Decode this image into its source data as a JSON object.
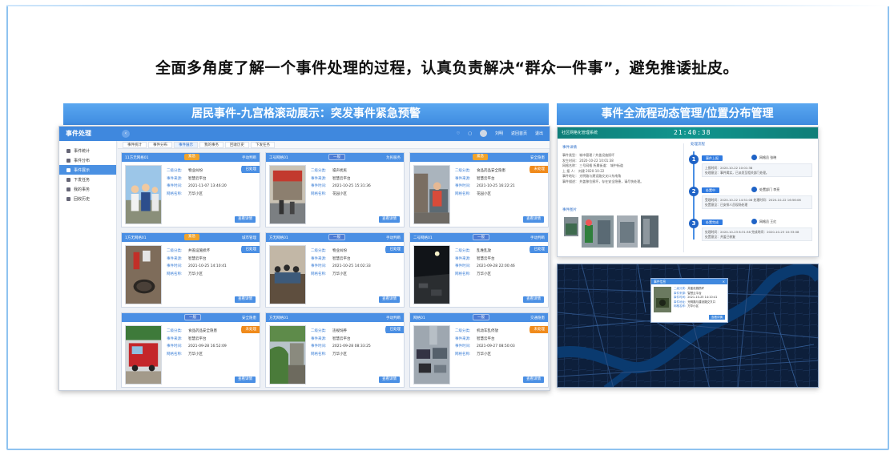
{
  "headline": "全面多角度了解一个事件处理的过程，认真负责解决“群众一件事”，避免推诿扯皮。",
  "left_section": {
    "title": "居民事件-九宫格滚动展示：突发事件紧急预警",
    "app": {
      "logo": "事件处理",
      "collapse_symbol": "‹",
      "top_right": [
        "♡",
        "▢",
        "刘明",
        "返回首页",
        "退出"
      ],
      "sidebar": [
        {
          "label": "事件统计",
          "active": false
        },
        {
          "label": "事件分布",
          "active": false
        },
        {
          "label": "事件展示",
          "active": true
        },
        {
          "label": "下发任务",
          "active": false
        },
        {
          "label": "我的事务",
          "active": false
        },
        {
          "label": "回收历史",
          "active": false
        }
      ],
      "tabs": [
        {
          "label": "事件统计",
          "active": false
        },
        {
          "label": "事件分布",
          "active": false
        },
        {
          "label": "事件展示",
          "active": true
        },
        {
          "label": "我的事务",
          "active": false
        },
        {
          "label": "回收历史",
          "active": false
        },
        {
          "label": "下发任务",
          "active": false
        }
      ],
      "field_keys": [
        "二级分类:",
        "事件来源:",
        "事件时间:",
        "网格名称:"
      ],
      "view_label": "查看详情",
      "cards": [
        {
          "title": "11方无网格01",
          "tag": "紧急",
          "tag_style": "urgent",
          "status": "手动判断",
          "ribbon": "已处理",
          "ribbon_style": "blue",
          "values": [
            "物业纠纷",
            "智慧云平台",
            "2021-11-07 13:46:20",
            "万华小区"
          ],
          "photo": "people"
        },
        {
          "title": "工号网格01",
          "tag": "一般",
          "tag_style": "normal",
          "status": "为民服务",
          "ribbon": "",
          "ribbon_style": "",
          "values": [
            "噪声扰民",
            "智慧云平台",
            "2021-10-25 15:31:36",
            "花园小区"
          ],
          "photo": "street"
        },
        {
          "title": "",
          "tag": "紧急",
          "tag_style": "urgent",
          "status": "安全隐患",
          "ribbon": "未处理",
          "ribbon_style": "orange",
          "values": [
            "食品药品安全隐患",
            "智慧云平台",
            "2021-10-25 16:22:21",
            "花园小区"
          ],
          "photo": "site"
        },
        {
          "title": "1方无网格01",
          "tag": "紧急",
          "tag_style": "urgent",
          "status": "城市管理",
          "ribbon": "已处理",
          "ribbon_style": "blue",
          "values": [
            "井盖设施损坏",
            "智慧云平台",
            "2021-10-25 14:10:41",
            "万华小区"
          ],
          "photo": "manhole"
        },
        {
          "title": "方无网格01",
          "tag": "一般",
          "tag_style": "normal",
          "status": "手动判断",
          "ribbon": "已处理",
          "ribbon_style": "blue",
          "values": [
            "物业纠纷",
            "智慧云平台",
            "2021-10-25 14:02:33",
            "万华小区"
          ],
          "photo": "meeting"
        },
        {
          "title": "二号网格01",
          "tag": "一般",
          "tag_style": "normal",
          "status": "手动判断",
          "ribbon": "已处理",
          "ribbon_style": "blue",
          "values": [
            "乱堆乱放",
            "智慧云平台",
            "2021-09-28 22:00:46",
            "万华小区"
          ],
          "photo": "night"
        },
        {
          "title": "",
          "tag": "一般",
          "tag_style": "normal",
          "status": "安全隐患",
          "ribbon": "未处理",
          "ribbon_style": "orange",
          "values": [
            "食品药品安全隐患",
            "智慧云平台",
            "2021-09-28 16:52:09",
            "万华小区"
          ],
          "photo": "vehicle"
        },
        {
          "title": "方无网格01",
          "tag": "",
          "tag_style": "",
          "status": "手动判断",
          "ribbon": "已处理",
          "ribbon_style": "blue",
          "values": [
            "违规饲养",
            "智慧云平台",
            "2021-09-28 08:33:25",
            "万华小区"
          ],
          "photo": "garden"
        },
        {
          "title": "网格01",
          "tag": "一般",
          "tag_style": "normal",
          "status": "交通隐患",
          "ribbon": "未处理",
          "ribbon_style": "orange",
          "values": [
            "机动车乱停放",
            "智慧云平台",
            "2021-09-27 08:50:03",
            "万华小区"
          ],
          "photo": "parking"
        }
      ]
    }
  },
  "right_section": {
    "title": "事件全流程动态管理/位置分布管理",
    "process": {
      "system_name": "社区网格化管理系统",
      "clock": "21:40:38",
      "detail_heading": "事件详情",
      "detail_lines": [
        "事件类型：  城市管理 / 井盖设施损坏",
        "发生时间：  2020-10-22 10:01:38",
        "网格名称：  三号网格         所属街道：  城中街道",
        "上 报 人：  刘建  2020-10-22",
        "事件地址：  光明路与建设路交叉口东南角",
        "事件描述：  井盖移位损坏，存在安全隐患，请尽快处理。"
      ],
      "flow_heading": "处理流程",
      "images_heading": "事件图片",
      "steps": [
        {
          "num": "1",
          "badge": "事件上报",
          "who": "网格员  张晓",
          "lines": [
            "上报时间：2020-10-22 10:01:38",
            "处理意见：事件属实，已派发至相关部门处理。"
          ]
        },
        {
          "num": "2",
          "badge": "处置中",
          "who": "处置部门  李亮",
          "lines": [
            "受理时间：2020-10-22 14:51:08    处理时间：2020-10-22 16:56:06",
            "处置意见：已安排人员现场处理"
          ]
        },
        {
          "num": "3",
          "badge": "处置完成",
          "who": "网格员  王红",
          "lines": [
            "处理时间：2020-10-23 8:31:38    完成时间：2020-10-23 10:33:08",
            "处置意见：井盖已修复"
          ]
        }
      ]
    },
    "map_popup": {
      "title": "事件信息",
      "close": "×",
      "rows": [
        {
          "k": "二级分类:",
          "v": "井盖设施损坏"
        },
        {
          "k": "事件来源:",
          "v": "智慧云平台"
        },
        {
          "k": "事件时间:",
          "v": "2021-10-25 14:10:41"
        },
        {
          "k": "事件地址:",
          "v": "光明路与建设路交叉口"
        },
        {
          "k": "网格名称:",
          "v": "万华小区"
        }
      ],
      "button": "查看详情"
    }
  },
  "colors": {
    "accent": "#3f88de",
    "urgent": "#f0a32b",
    "pending": "#f08b1c",
    "frame": "#8fc3f0",
    "map_bg": "#0d1f3b",
    "header_teal": "#11958e"
  }
}
